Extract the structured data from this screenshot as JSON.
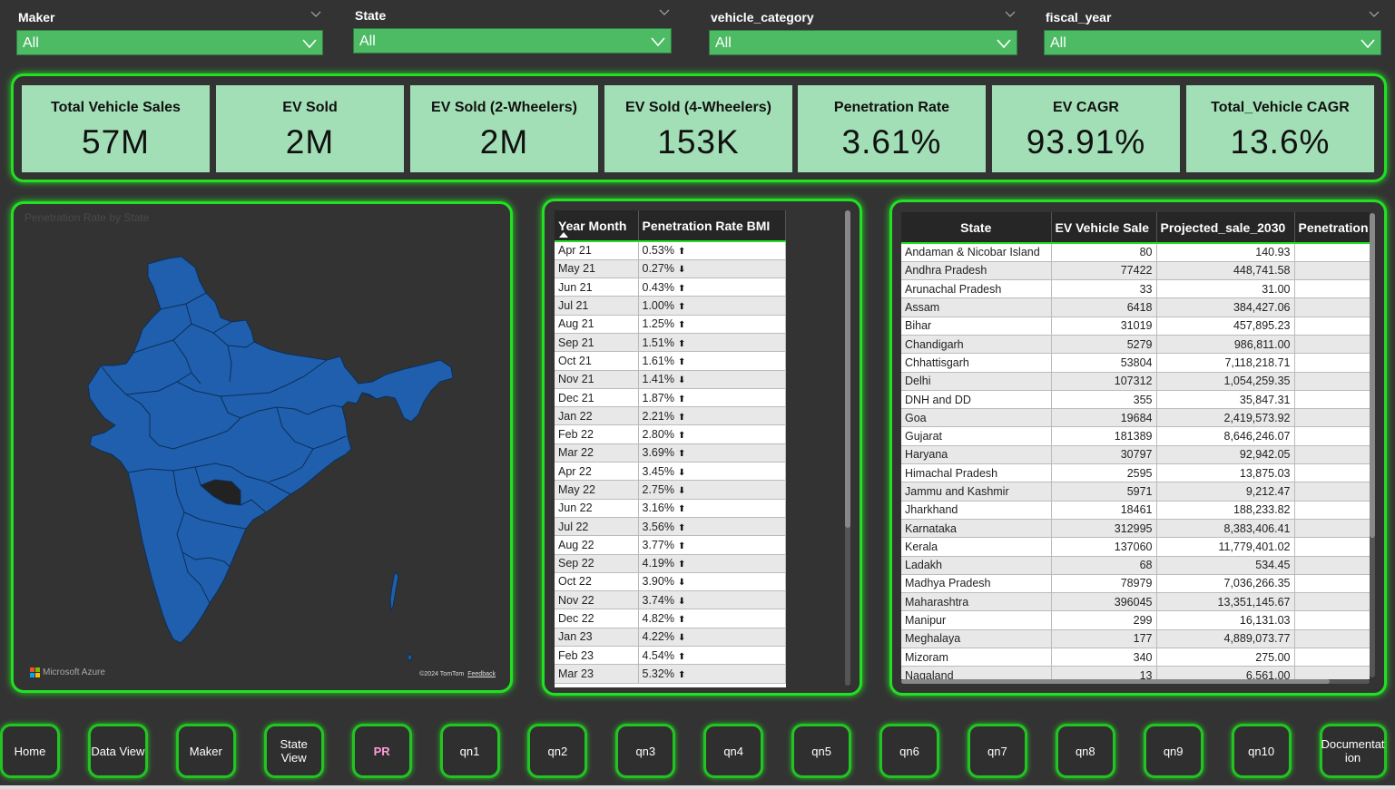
{
  "filters": [
    {
      "title": "Maker",
      "value": "All"
    },
    {
      "title": "State",
      "value": "All"
    },
    {
      "title": "vehicle_category",
      "value": "All"
    },
    {
      "title": "fiscal_year",
      "value": "All"
    }
  ],
  "kpis": [
    {
      "label": "Total Vehicle Sales",
      "value": "57M"
    },
    {
      "label": "EV Sold",
      "value": "2M"
    },
    {
      "label": "EV Sold (2-Wheelers)",
      "value": "2M"
    },
    {
      "label": "EV Sold (4-Wheelers)",
      "value": "153K"
    },
    {
      "label": "Penetration Rate",
      "value": "3.61%"
    },
    {
      "label": "EV CAGR",
      "value": "93.91%"
    },
    {
      "label": "Total_Vehicle CAGR",
      "value": "13.6%"
    }
  ],
  "map": {
    "title": "Penetration Rate by State",
    "attribution_left": "Microsoft Azure",
    "attribution_right": "©2024 TomTom",
    "feedback": "Feedback",
    "fill_color": "#1f5fad"
  },
  "pr_table": {
    "columns": [
      "Year Month",
      "Penetration Rate BMI"
    ],
    "rows": [
      [
        "Apr 21",
        "0.53%",
        "up"
      ],
      [
        "May 21",
        "0.27%",
        "down"
      ],
      [
        "Jun 21",
        "0.43%",
        "up"
      ],
      [
        "Jul 21",
        "1.00%",
        "up"
      ],
      [
        "Aug 21",
        "1.25%",
        "up"
      ],
      [
        "Sep 21",
        "1.51%",
        "up"
      ],
      [
        "Oct 21",
        "1.61%",
        "up"
      ],
      [
        "Nov 21",
        "1.41%",
        "down"
      ],
      [
        "Dec 21",
        "1.87%",
        "up"
      ],
      [
        "Jan 22",
        "2.21%",
        "up"
      ],
      [
        "Feb 22",
        "2.80%",
        "up"
      ],
      [
        "Mar 22",
        "3.69%",
        "up"
      ],
      [
        "Apr 22",
        "3.45%",
        "down"
      ],
      [
        "May 22",
        "2.75%",
        "down"
      ],
      [
        "Jun 22",
        "3.16%",
        "up"
      ],
      [
        "Jul 22",
        "3.56%",
        "up"
      ],
      [
        "Aug 22",
        "3.77%",
        "up"
      ],
      [
        "Sep 22",
        "4.19%",
        "up"
      ],
      [
        "Oct 22",
        "3.90%",
        "down"
      ],
      [
        "Nov 22",
        "3.74%",
        "down"
      ],
      [
        "Dec 22",
        "4.82%",
        "up"
      ],
      [
        "Jan 23",
        "4.22%",
        "down"
      ],
      [
        "Feb 23",
        "4.54%",
        "up"
      ],
      [
        "Mar 23",
        "5.32%",
        "up"
      ]
    ]
  },
  "state_table": {
    "columns": [
      "State",
      "EV Vehicle Sale",
      "Projected_sale_2030",
      "Penetration"
    ],
    "rows": [
      [
        "Andaman & Nicobar Island",
        "80",
        "140.93"
      ],
      [
        "Andhra Pradesh",
        "77422",
        "448,741.58"
      ],
      [
        "Arunachal Pradesh",
        "33",
        "31.00"
      ],
      [
        "Assam",
        "6418",
        "384,427.06"
      ],
      [
        "Bihar",
        "31019",
        "457,895.23"
      ],
      [
        "Chandigarh",
        "5279",
        "986,811.00"
      ],
      [
        "Chhattisgarh",
        "53804",
        "7,118,218.71"
      ],
      [
        "Delhi",
        "107312",
        "1,054,259.35"
      ],
      [
        "DNH and DD",
        "355",
        "35,847.31"
      ],
      [
        "Goa",
        "19684",
        "2,419,573.92"
      ],
      [
        "Gujarat",
        "181389",
        "8,646,246.07"
      ],
      [
        "Haryana",
        "30797",
        "92,942.05"
      ],
      [
        "Himachal Pradesh",
        "2595",
        "13,875.03"
      ],
      [
        "Jammu and Kashmir",
        "5971",
        "9,212.47"
      ],
      [
        "Jharkhand",
        "18461",
        "188,233.82"
      ],
      [
        "Karnataka",
        "312995",
        "8,383,406.41"
      ],
      [
        "Kerala",
        "137060",
        "11,779,401.02"
      ],
      [
        "Ladakh",
        "68",
        "534.45"
      ],
      [
        "Madhya Pradesh",
        "78979",
        "7,036,266.35"
      ],
      [
        "Maharashtra",
        "396045",
        "13,351,145.67"
      ],
      [
        "Manipur",
        "299",
        "16,131.03"
      ],
      [
        "Meghalaya",
        "177",
        "4,889,073.77"
      ],
      [
        "Mizoram",
        "340",
        "275.00"
      ],
      [
        "Nagaland",
        "13",
        "6,561.00"
      ]
    ]
  },
  "nav": [
    {
      "label": "Home"
    },
    {
      "label": "Data View"
    },
    {
      "label": "Maker"
    },
    {
      "label": "State View"
    },
    {
      "label": "PR",
      "active": true
    },
    {
      "label": "qn1"
    },
    {
      "label": "qn2"
    },
    {
      "label": "qn3"
    },
    {
      "label": "qn4"
    },
    {
      "label": "qn5"
    },
    {
      "label": "qn6"
    },
    {
      "label": "qn7"
    },
    {
      "label": "qn8"
    },
    {
      "label": "qn9"
    },
    {
      "label": "qn10"
    },
    {
      "label": "Documentat ion"
    }
  ]
}
